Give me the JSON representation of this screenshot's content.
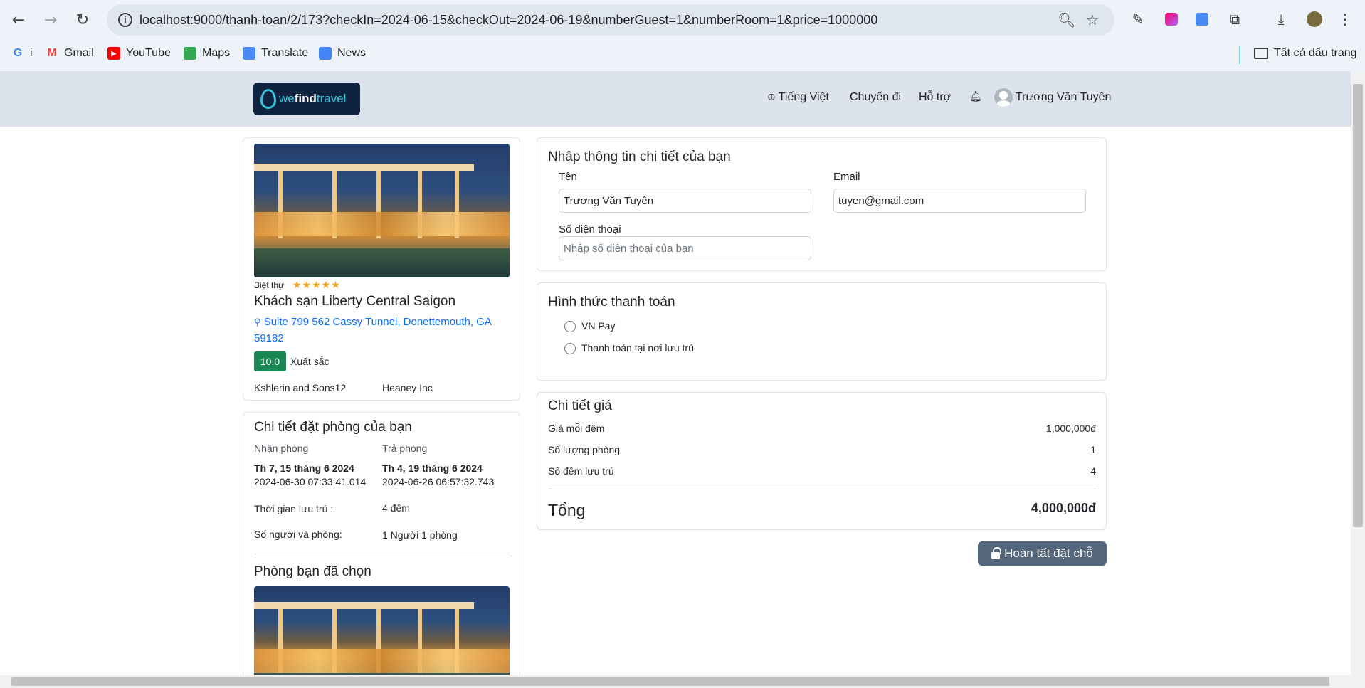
{
  "browser": {
    "url": "localhost:9000/thanh-toan/2/173?checkIn=2024-06-15&checkOut=2024-06-19&numberGuest=1&numberRoom=1&price=1000000",
    "bookmarks": [
      {
        "label": "i",
        "icon": "google-icon"
      },
      {
        "label": "Gmail",
        "icon": "gmail-icon"
      },
      {
        "label": "YouTube",
        "icon": "youtube-icon"
      },
      {
        "label": "Maps",
        "icon": "maps-icon"
      },
      {
        "label": "Translate",
        "icon": "translate-icon"
      },
      {
        "label": "News",
        "icon": "news-icon"
      }
    ],
    "all_bookmarks": "Tất cả dấu trang"
  },
  "header": {
    "logo_prefix": "we",
    "logo_bold": "find",
    "logo_suffix": "travel",
    "language": "Tiếng Việt",
    "trips": "Chuyến đi",
    "support": "Hỗ trợ",
    "user_name": "Trương Văn Tuyên"
  },
  "hotel": {
    "type": "Biệt thự",
    "stars": "★★★★★",
    "name": "Khách sạn Liberty Central Saigon",
    "address_line1": "Suite 799 562 Cassy Tunnel, Donettemouth, GA",
    "address_line2": "59182",
    "score": "10.0",
    "score_label": "Xuất sắc",
    "tag1": "Kshlerin and Sons12",
    "tag2": "Heaney Inc"
  },
  "booking": {
    "title": "Chi tiết đặt phòng của bạn",
    "checkin_label": "Nhận phòng",
    "checkout_label": "Trả phòng",
    "checkin_date": "Th 7, 15 tháng 6 2024",
    "checkout_date": "Th 4, 19 tháng 6 2024",
    "checkin_time": "2024-06-30 07:33:41.014",
    "checkout_time": "2024-06-26 06:57:32.743",
    "duration_label": "Thời gian lưu trú :",
    "duration_value": "4 đêm",
    "guests_label": "Số người và phòng:",
    "guests_value": "1 Người 1 phòng",
    "rooms_title": "Phòng bạn đã chọn"
  },
  "details_form": {
    "title": "Nhập thông tin chi tiết của bạn",
    "name_label": "Tên",
    "name_value": "Trương Văn Tuyên",
    "email_label": "Email",
    "email_value": "tuyen@gmail.com",
    "phone_label": "Số điện thoại",
    "phone_placeholder": "Nhập số điện thoại của bạn"
  },
  "payment": {
    "title": "Hình thức thanh toán",
    "option1": "VN Pay",
    "option2": "Thanh toán tại nơi lưu trú"
  },
  "price": {
    "title": "Chi tiết giá",
    "per_night_label": "Giá mỗi đêm",
    "per_night_value": "1,000,000đ",
    "rooms_label": "Số lượng phòng",
    "rooms_value": "1",
    "nights_label": "Số đêm lưu trú",
    "nights_value": "4",
    "total_label": "Tổng",
    "total_value": "4,000,000đ"
  },
  "submit_label": "Hoàn tất đặt chỗ",
  "colors": {
    "accent": "#198754",
    "button": "#53667c",
    "link": "#0d6efd",
    "header": "#dce3ec"
  }
}
